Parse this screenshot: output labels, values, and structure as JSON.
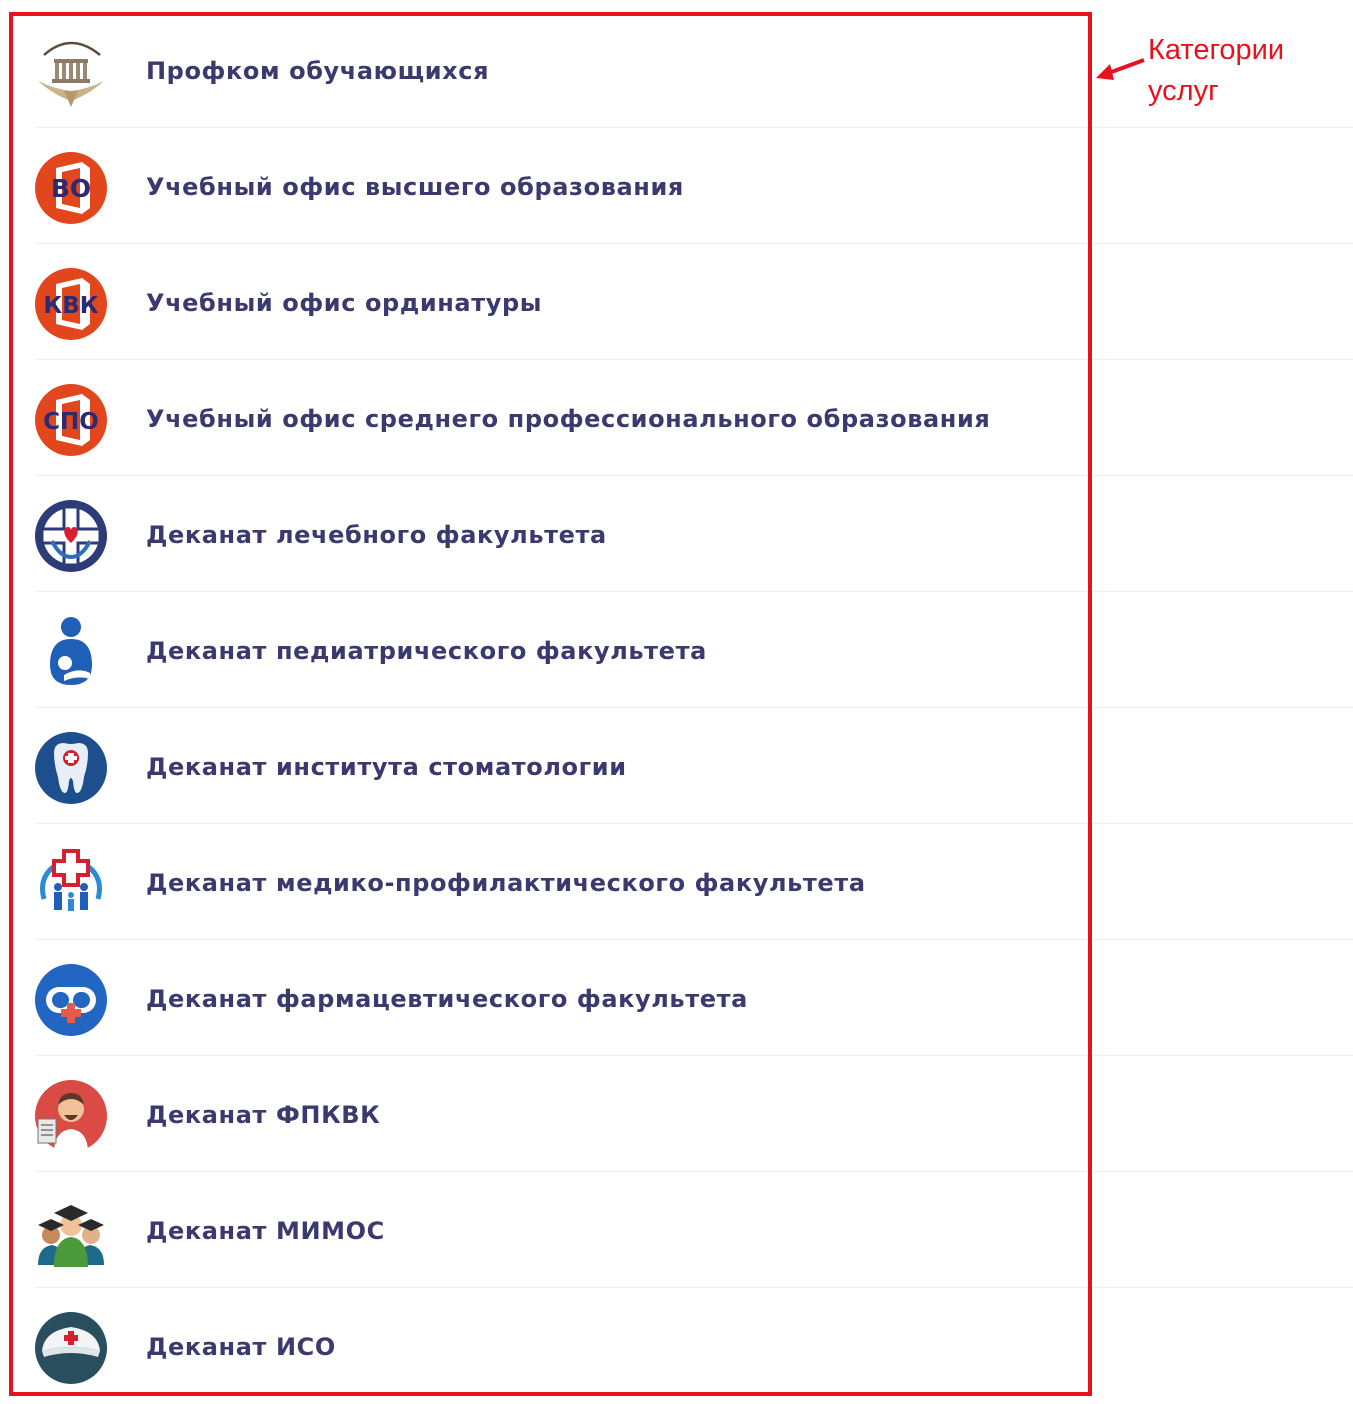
{
  "service_categories": [
    {
      "label": "Профком обучающихся",
      "icon": "building-icon"
    },
    {
      "label": "Учебный офис высшего образования",
      "icon": "vo-office-icon",
      "icon_text": "ВО"
    },
    {
      "label": "Учебный офис ординатуры",
      "icon": "kvk-office-icon",
      "icon_text": "КВК"
    },
    {
      "label": "Учебный офис среднего профессионального образования",
      "icon": "spo-office-icon",
      "icon_text": "СПО"
    },
    {
      "label": "Деканат лечебного факультета",
      "icon": "heart-hands-icon"
    },
    {
      "label": "Деканат педиатрического факультета",
      "icon": "mother-child-icon"
    },
    {
      "label": "Деканат института стоматологии",
      "icon": "tooth-icon"
    },
    {
      "label": "Деканат медико-профилактического факультета",
      "icon": "family-cross-icon"
    },
    {
      "label": "Деканат фармацевтического факультета",
      "icon": "pill-cross-icon"
    },
    {
      "label": "Деканат ФПКВК",
      "icon": "doctor-icon"
    },
    {
      "label": "Деканат МИМОС",
      "icon": "graduates-icon"
    },
    {
      "label": "Деканат ИСО",
      "icon": "nurse-cap-icon"
    }
  ],
  "annotation": {
    "line1": "Категории",
    "line2": "услуг"
  },
  "colors": {
    "label": "#3b3a6e",
    "annotation_red": "#e8111c",
    "office_orange": "#e2461c",
    "dean_navy": "#2d3b78",
    "dean_blue": "#2d6fbf",
    "divider": "#eceef1"
  }
}
